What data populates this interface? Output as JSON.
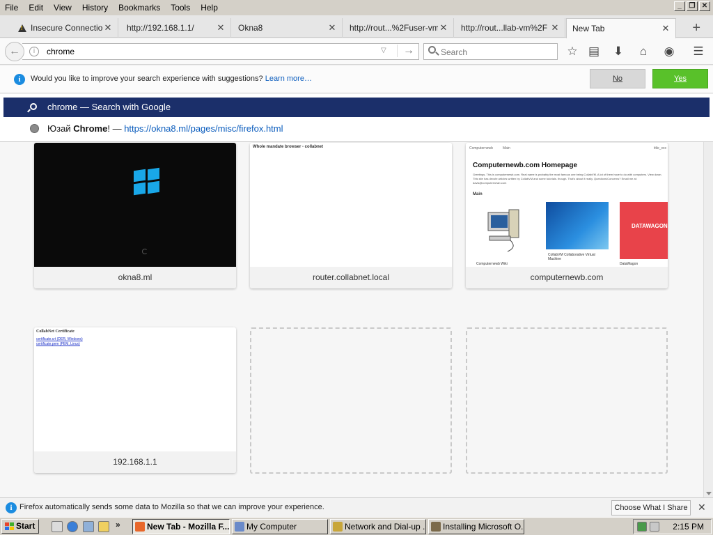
{
  "menubar": {
    "items": [
      "File",
      "Edit",
      "View",
      "History",
      "Bookmarks",
      "Tools",
      "Help"
    ]
  },
  "window_controls": [
    "_",
    "❐",
    "✕"
  ],
  "tabs": [
    {
      "title": "Insecure Connection",
      "icon": "warning-icon"
    },
    {
      "title": "http://192.168.1.1/"
    },
    {
      "title": "Okna8"
    },
    {
      "title": "http://rout...%2Fuser-vm"
    },
    {
      "title": "http://rout...llab-vm%2F"
    },
    {
      "title": "New Tab",
      "selected": true
    }
  ],
  "newtab_button": "+",
  "navbar": {
    "url_value": "chrome",
    "search_placeholder": "Search",
    "icons": [
      "back-icon",
      "info-icon",
      "go-arrow-icon",
      "search-icon",
      "star-icon",
      "reading-list-icon",
      "download-icon",
      "home-icon",
      "pocket-icon",
      "menu-icon"
    ]
  },
  "suggest_bar": {
    "message": "Would you like to improve your search experience with suggestions?",
    "link": "Learn more…",
    "no_label": "No",
    "yes_label": "Yes"
  },
  "autocomplete": {
    "row1_query": "chrome",
    "row1_action": "— Search with Google",
    "row2_title_prefix": "Юзай ",
    "row2_title_bold": "Chrome",
    "row2_title_suffix": "!",
    "row2_dash": "—",
    "row2_url": "https://okna8.ml/pages/misc/firefox.html"
  },
  "tiles": [
    {
      "label": "okna8.ml"
    },
    {
      "label": "router.collabnet.local",
      "thumb_text": "Whole mandate browser - collabnet"
    },
    {
      "label": "computernewb.com",
      "thumb_title": "Computernewb.com Homepage",
      "thumb_nav_left": "Computernewb",
      "thumb_nav_mid": "Main",
      "thumb_nav_right": "title_xxx",
      "thumb_body": "Greetings. This is computernewb.com. Real name is probably the most famous one being CollabVM. A lot of them have to do with computers. View down. This site has devote articles written by CollabVM and some tutorials. though. That's about it really. Questions/Concerns? Email me at: davis@computernewb.com",
      "thumb_main": "Main",
      "thumb_datawagon": "DATAWAGON",
      "thumb_cap1": "Computernewb Wiki",
      "thumb_cap2": "CollabVM Collaborative Virtual Machine",
      "thumb_cap3": "DataWagon"
    },
    {
      "label": "192.168.1.1",
      "thumb_title": "CollabNet Certificate",
      "thumb_link1": "certificate.crt (DER, Windows)",
      "thumb_link2": "certificate.pem (PEM, Linux)"
    }
  ],
  "data_bar": {
    "message": "Firefox automatically sends some data to Mozilla so that we can improve your experience.",
    "choose_label": "Choose What I Share",
    "close": "✕"
  },
  "taskbar": {
    "start_label": "Start",
    "ql_more": "»",
    "tasks": [
      {
        "label": "New Tab - Mozilla F...",
        "active": true,
        "color": "#e8672a"
      },
      {
        "label": "My Computer",
        "active": false,
        "color": "#6a8ac9"
      },
      {
        "label": "Network and Dial-up ...",
        "active": false,
        "color": "#c8a63a"
      },
      {
        "label": "Installing Microsoft O...",
        "active": false,
        "color": "#7b6a4a"
      }
    ],
    "clock": "2:15 PM"
  },
  "colors": {
    "accent_blue": "#1b2f6a",
    "yes_green": "#59c12a",
    "info_blue": "#1b8ce0",
    "windows_logo": "#19a7e8",
    "datawagon_red": "#e8434a"
  }
}
